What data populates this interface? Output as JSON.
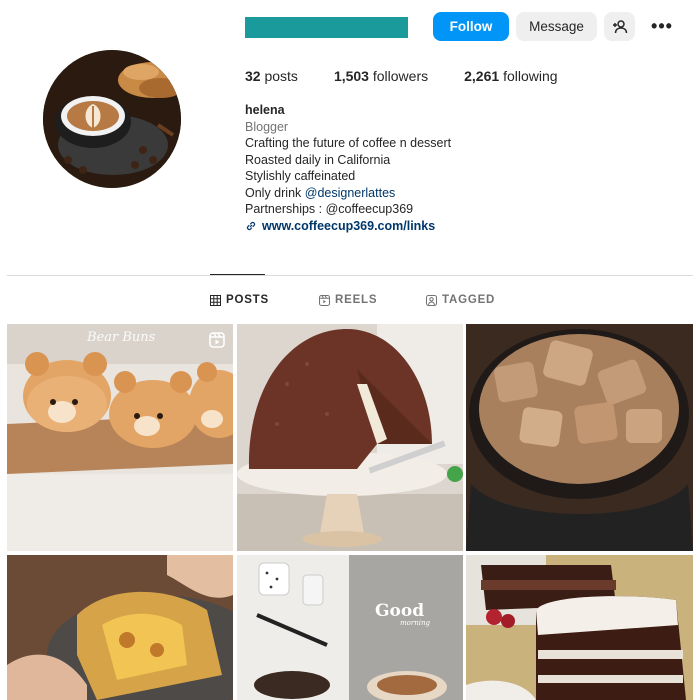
{
  "header": {
    "follow_label": "Follow",
    "message_label": "Message",
    "suggest_icon": "person-add-icon",
    "more_icon": "more-dots-icon",
    "more_label": "•••",
    "username_bar_color": "#1a9a9a",
    "accent_color": "#0095f6"
  },
  "stats": {
    "posts_count": "32",
    "posts_label": "posts",
    "followers_count": "1,503",
    "followers_label": "followers",
    "following_count": "2,261",
    "following_label": "following"
  },
  "bio": {
    "name": "helena",
    "category": "Blogger",
    "line1": "Crafting the future of coffee n dessert",
    "line2": "Roasted daily in California",
    "line3": "Stylishly caffeinated",
    "line4_prefix": "Only drink ",
    "line4_mention": "@designerlattes",
    "line5": "Partnerships : @coffeecup369",
    "link": "www.coffeecup369.com/links"
  },
  "tabs": [
    {
      "label": "POSTS",
      "icon": "grid-icon",
      "active": true
    },
    {
      "label": "REELS",
      "icon": "reels-icon",
      "active": false
    },
    {
      "label": "TAGGED",
      "icon": "tagged-icon",
      "active": false
    }
  ],
  "posts": [
    {
      "subject": "bear-buns",
      "caption": "Bear Buns",
      "is_reel": true
    },
    {
      "subject": "chocolate-dome-cake"
    },
    {
      "subject": "iced-coffee"
    },
    {
      "subject": "cheesy-bread"
    },
    {
      "subject": "good-morning-coffee",
      "caption": "Good",
      "caption_sub": "morning"
    },
    {
      "subject": "chocolate-cake-slice"
    }
  ]
}
